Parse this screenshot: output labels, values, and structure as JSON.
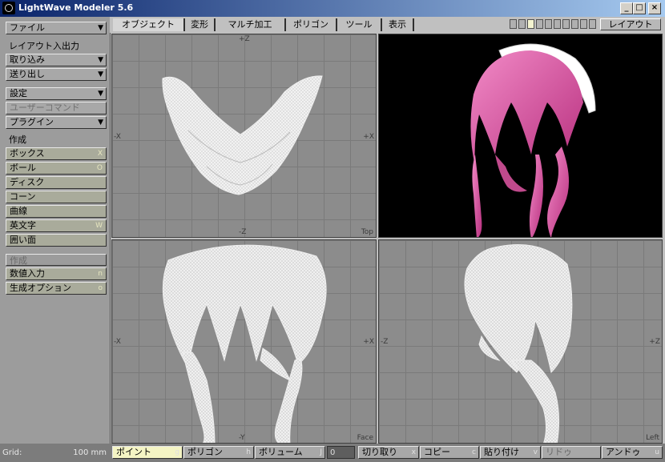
{
  "window": {
    "title": "LightWave Modeler 5.6"
  },
  "left_panel": {
    "file": "ファイル",
    "layout_io": "レイアウト入出力",
    "import": "取り込み",
    "export": "送り出し",
    "settings": "設定",
    "user_command": "ユーザーコマンド",
    "plugin": "プラグイン",
    "create_heading": "作成",
    "create_items": [
      {
        "label": "ボックス",
        "key": "X"
      },
      {
        "label": "ボール",
        "key": "O"
      },
      {
        "label": "ディスク",
        "key": ""
      },
      {
        "label": "コーン",
        "key": ""
      },
      {
        "label": "曲線",
        "key": ""
      },
      {
        "label": "英文字",
        "key": "W"
      },
      {
        "label": "囲い面",
        "key": ""
      }
    ],
    "create_heading2": "作成",
    "numeric": {
      "label": "数値入力",
      "key": "n"
    },
    "gen_options": {
      "label": "生成オプション",
      "key": "o"
    }
  },
  "tabs": [
    "オブジェクト",
    "変形",
    "マルチ加工",
    "ポリゴン",
    "ツール",
    "表示"
  ],
  "active_tab": 0,
  "layout_button": "レイアウト",
  "viewports": {
    "top": {
      "name": "Top",
      "axis_top": "+Z",
      "axis_bottom": "-Z",
      "axis_left": "-X",
      "axis_right": "+X"
    },
    "face": {
      "name": "Face",
      "axis_left": "-X",
      "axis_right": "+X",
      "axis_bottom": "-Y"
    },
    "left": {
      "name": "Left",
      "axis_left": "-Z",
      "axis_right": "+Z"
    }
  },
  "status": {
    "grid_label": "Grid:",
    "grid_value": "100 mm",
    "buttons": [
      {
        "label": "ポイント",
        "key": "g"
      },
      {
        "label": "ポリゴン",
        "key": "h"
      },
      {
        "label": "ボリューム",
        "key": "J"
      }
    ],
    "counter": "0",
    "edit": [
      {
        "label": "切り取り",
        "key": "x"
      },
      {
        "label": "コピー",
        "key": "c"
      },
      {
        "label": "貼り付け",
        "key": "v"
      },
      {
        "label": "リドゥ",
        "key": ""
      },
      {
        "label": "アンドゥ",
        "key": "u"
      }
    ]
  },
  "colors": {
    "hair": "#e05aa8",
    "headband": "#ffffff",
    "wire": "#e8e8e8"
  }
}
